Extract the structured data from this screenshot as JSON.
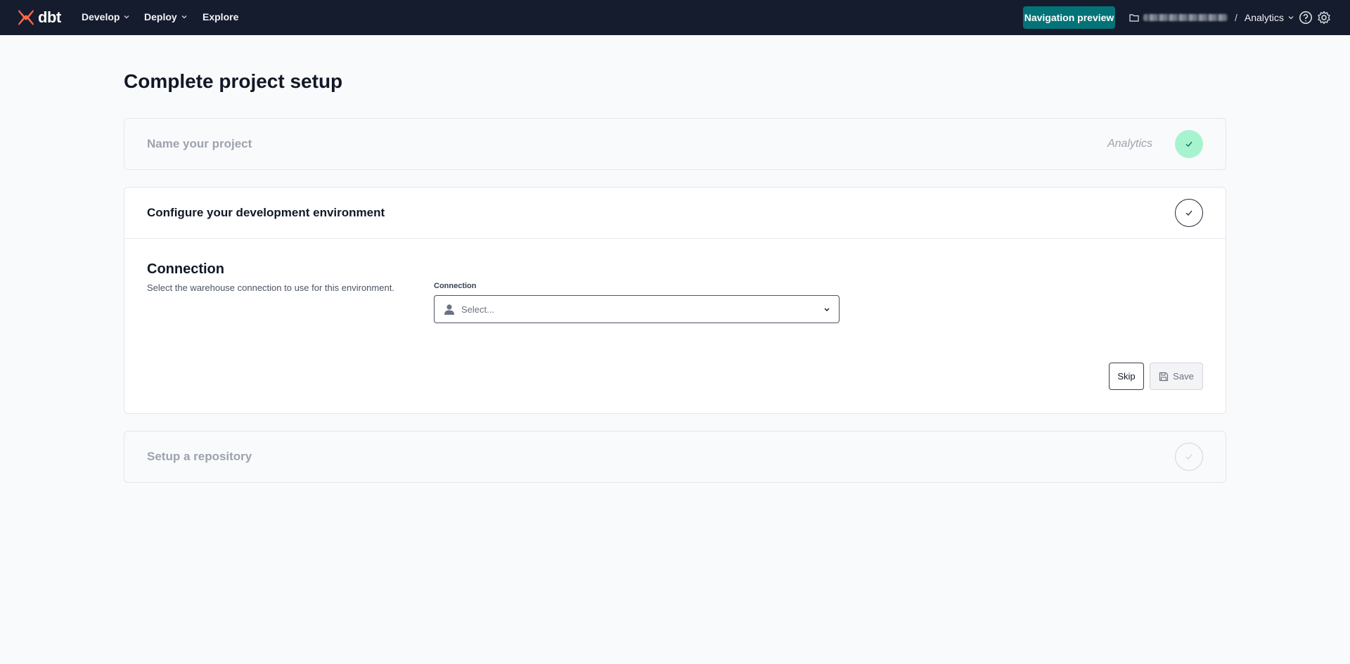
{
  "app": {
    "logo_text": "dbt"
  },
  "nav": {
    "items": [
      {
        "label": "Develop"
      },
      {
        "label": "Deploy"
      },
      {
        "label": "Explore"
      }
    ],
    "preview_button": "Navigation preview",
    "account": {
      "separator": "/",
      "project": "Analytics"
    }
  },
  "page": {
    "title": "Complete project setup"
  },
  "steps": {
    "name_project": {
      "title": "Name your project",
      "value": "Analytics",
      "status": "done"
    },
    "dev_env": {
      "title": "Configure your development environment",
      "status": "active",
      "section_title": "Connection",
      "section_desc": "Select the warehouse connection to use for this environment.",
      "field_label": "Connection",
      "select_placeholder": "Select...",
      "skip_label": "Skip",
      "save_label": "Save"
    },
    "repo": {
      "title": "Setup a repository",
      "status": "pending"
    }
  },
  "colors": {
    "topbar": "#151c2e",
    "accent": "#047377",
    "brand_logo": "#ff694a",
    "done_check": "#a7f3d0"
  }
}
